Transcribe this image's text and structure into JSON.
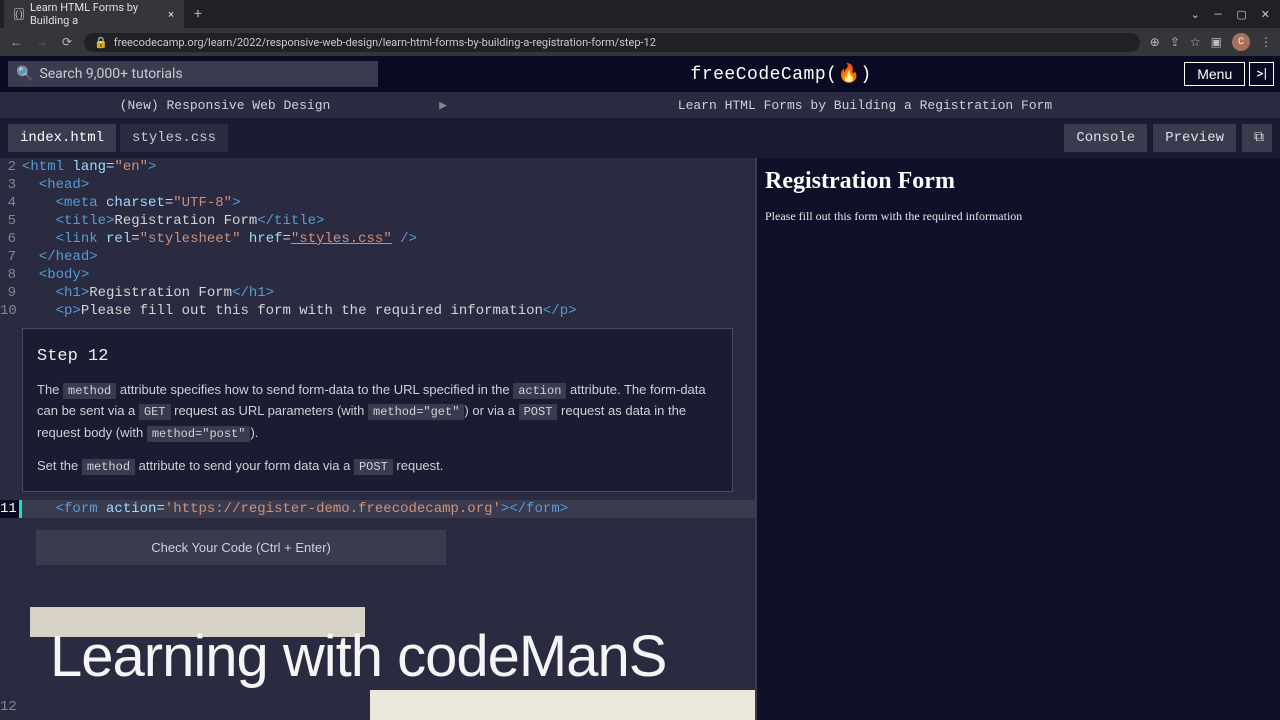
{
  "browser": {
    "tab_title": "Learn HTML Forms by Building a ",
    "url": "freecodecamp.org/learn/2022/responsive-web-design/learn-html-forms-by-building-a-registration-form/step-12",
    "avatar_letter": "C"
  },
  "header": {
    "search_placeholder": "Search 9,000+ tutorials",
    "logo": "freeCodeCamp(",
    "logo_icon": "🔥",
    "logo_close": ")",
    "menu": "Menu"
  },
  "breadcrumb": {
    "course": "(New) Responsive Web Design",
    "lesson": "Learn HTML Forms by Building a Registration Form"
  },
  "tabs": {
    "file1": "index.html",
    "file2": "styles.css",
    "console": "Console",
    "preview": "Preview"
  },
  "code": {
    "l2": "<html lang=\"en\">",
    "l3": "  <head>",
    "l4": "    <meta charset=\"UTF-8\">",
    "l5": "    <title>Registration Form</title>",
    "l6": "    <link rel=\"stylesheet\" href=\"styles.css\" />",
    "l7": "  </head>",
    "l8": "  <body>",
    "l9": "    <h1>Registration Form</h1>",
    "l10": "    <p>Please fill out this form with the required information</p>",
    "l11": "    <form action='https://register-demo.freecodecamp.org'></form>",
    "l12": "",
    "g2": "2",
    "g3": "3",
    "g4": "4",
    "g5": "5",
    "g6": "6",
    "g7": "7",
    "g8": "8",
    "g9": "9",
    "g10": "10",
    "g11": "11",
    "g12": "12"
  },
  "step": {
    "title": "Step 12",
    "t1": "The ",
    "c1": "method",
    "t2": " attribute specifies how to send form-data to the URL specified in the ",
    "c2": "action",
    "t3": " attribute. The form-data can be sent via a ",
    "c3": "GET",
    "t4": " request as URL parameters (with ",
    "c4": "method=\"get\"",
    "t5": ") or via a ",
    "c5": "POST",
    "t6": " request as data in the request body (with ",
    "c6": "method=\"post\"",
    "t7": ").",
    "p2a": "Set the ",
    "p2b": "method",
    "p2c": " attribute to send your form data via a ",
    "p2d": "POST",
    "p2e": " request."
  },
  "actions": {
    "check": "Check Your Code (Ctrl + Enter)"
  },
  "preview": {
    "h1": "Registration Form",
    "p": "Please fill out this form with the required information"
  },
  "overlay": "Learning with codeManS"
}
